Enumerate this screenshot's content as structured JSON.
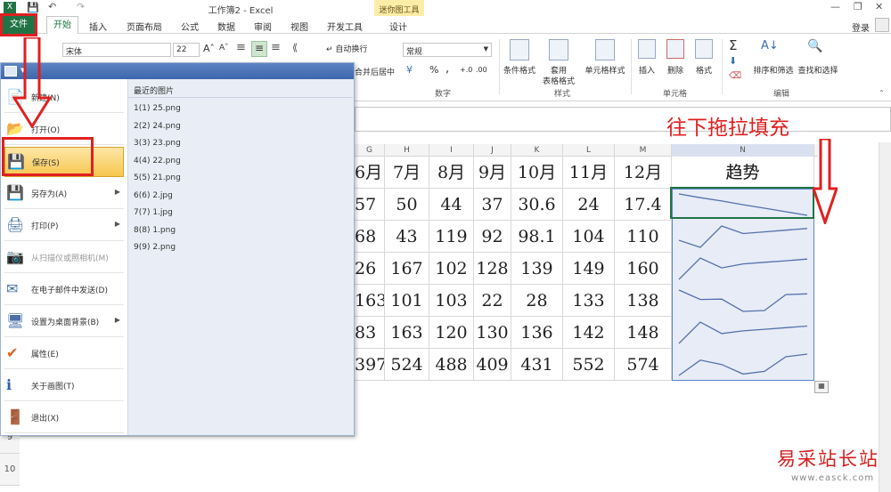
{
  "window": {
    "title": "工作簿2 - Excel",
    "context_group": "迷你图工具",
    "signin": "登录"
  },
  "tabs": [
    "文件",
    "开始",
    "插入",
    "页面布局",
    "公式",
    "数据",
    "审阅",
    "视图",
    "开发工具",
    "设计"
  ],
  "ribbon": {
    "font_name": "宋体",
    "font_size": "22",
    "wrap_text": "自动换行",
    "merge_center": "合并后居中",
    "number_format": "常规",
    "number_group": "数字",
    "style_group": "样式",
    "cells_group": "单元格",
    "edit_group": "编辑",
    "conditional_format": "条件格式",
    "format_as_table_1": "套用",
    "format_as_table_2": "表格格式",
    "cell_styles": "单元格样式",
    "insert": "插入",
    "delete": "删除",
    "format": "格式",
    "sort_filter": "排序和筛选",
    "find_select": "查找和选择",
    "percent": "%",
    "comma": ","
  },
  "file_menu": {
    "items": [
      {
        "label": "新建(N)",
        "icon": "new-file-icon",
        "arrow": false,
        "highlighted": false,
        "disabled": false
      },
      {
        "label": "打开(O)",
        "icon": "open-folder-icon",
        "arrow": false,
        "highlighted": false,
        "disabled": false
      },
      {
        "label": "保存(S)",
        "icon": "save-disk-icon",
        "arrow": false,
        "highlighted": true,
        "disabled": false
      },
      {
        "label": "另存为(A)",
        "icon": "save-as-icon",
        "arrow": true,
        "highlighted": false,
        "disabled": false
      },
      {
        "label": "打印(P)",
        "icon": "printer-icon",
        "arrow": true,
        "highlighted": false,
        "disabled": false
      },
      {
        "label": "从扫描仪或照相机(M)",
        "icon": "scanner-icon",
        "arrow": false,
        "highlighted": false,
        "disabled": true
      },
      {
        "label": "在电子邮件中发送(D)",
        "icon": "email-icon",
        "arrow": false,
        "highlighted": false,
        "disabled": false
      },
      {
        "label": "设置为桌面背景(B)",
        "icon": "desktop-icon",
        "arrow": true,
        "highlighted": false,
        "disabled": false
      },
      {
        "label": "属性(E)",
        "icon": "checkmark-icon",
        "arrow": false,
        "highlighted": false,
        "disabled": false
      },
      {
        "label": "关于画图(T)",
        "icon": "info-icon",
        "arrow": false,
        "highlighted": false,
        "disabled": false
      },
      {
        "label": "退出(X)",
        "icon": "exit-icon",
        "arrow": false,
        "highlighted": false,
        "disabled": false
      }
    ],
    "recent_title": "最近的图片",
    "recent": [
      "1(1) 25.png",
      "2(2) 24.png",
      "3(3) 23.png",
      "4(4) 22.png",
      "5(5) 21.png",
      "6(6) 2.jpg",
      "7(7) 1.jpg",
      "8(8) 1.png",
      "9(9) 2.png"
    ]
  },
  "sheet": {
    "columns": [
      "G",
      "H",
      "I",
      "J",
      "K",
      "L",
      "M",
      "N"
    ],
    "header_row": [
      "6月",
      "7月",
      "8月",
      "9月",
      "10月",
      "11月",
      "12月",
      "趋势"
    ],
    "rows": [
      [
        "57",
        "50",
        "44",
        "37",
        "30.6",
        "24",
        "17.4"
      ],
      [
        "68",
        "43",
        "119",
        "92",
        "98.1",
        "104",
        "110"
      ],
      [
        "26",
        "167",
        "102",
        "128",
        "139",
        "149",
        "160"
      ],
      [
        "163",
        "101",
        "103",
        "22",
        "28",
        "133",
        "138"
      ],
      [
        "83",
        "163",
        "120",
        "130",
        "136",
        "142",
        "148"
      ],
      [
        "397",
        "524",
        "488",
        "409",
        "431",
        "552",
        "574"
      ]
    ],
    "row_numbers": [
      "9",
      "10"
    ],
    "sparkline_color": "#5470a8"
  },
  "annotation": {
    "text": "往下拖拉填充",
    "color": "#e02020"
  },
  "watermark": {
    "text": "易采站长站",
    "url": "www.easck.com"
  },
  "colors": {
    "excel_green": "#217346",
    "menu_highlight": "#f7c64f",
    "selection_fill": "#e7ecf7"
  }
}
